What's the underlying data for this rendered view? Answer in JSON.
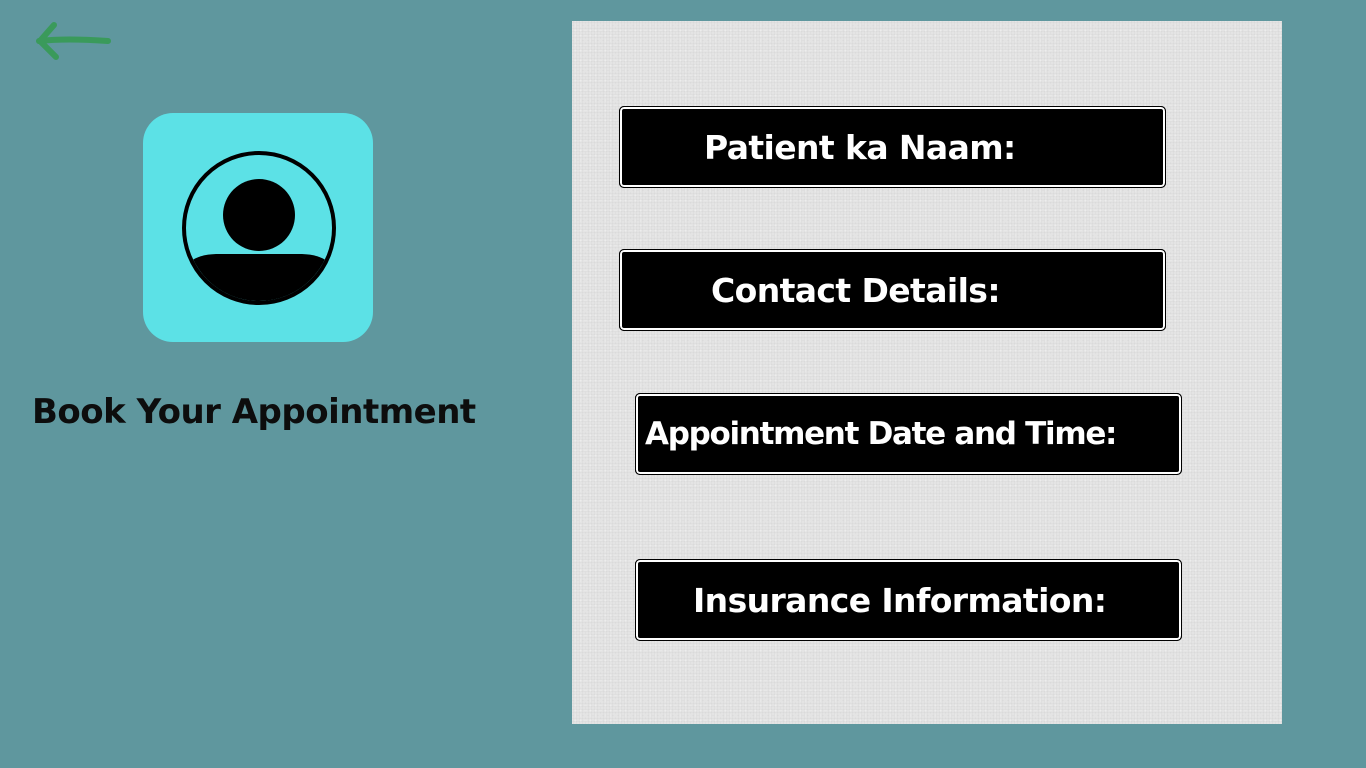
{
  "colors": {
    "background": "#5f979e",
    "panel": "#e4e4e4",
    "avatar_tile": "#5ce1e6",
    "back_arrow": "#3a9a5b",
    "field_fill": "#000000",
    "field_text": "#ffffff",
    "title_text": "#0d0d0d"
  },
  "nav": {
    "back_icon": "arrow-left-icon"
  },
  "profile": {
    "avatar_icon": "user-avatar-icon",
    "title": "Book Your Appointment"
  },
  "form": {
    "fields": [
      {
        "label": "Patient ka Naam:"
      },
      {
        "label": "Contact Details:"
      },
      {
        "label": "Appointment Date and Time:"
      },
      {
        "label": "Insurance Information:"
      }
    ]
  }
}
